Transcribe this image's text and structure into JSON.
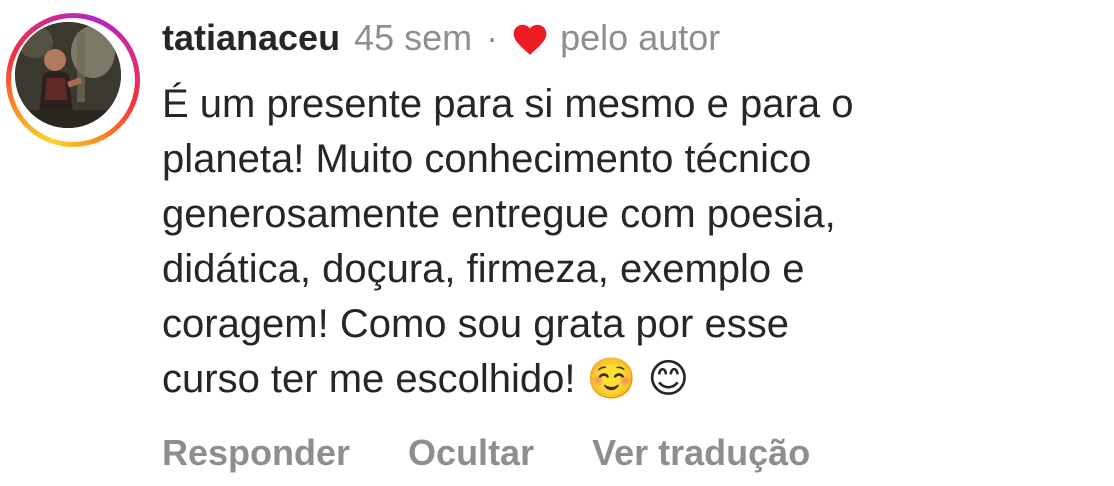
{
  "comment": {
    "username": "tatianaceu",
    "timestamp": "45 sem",
    "separator": "·",
    "liked_by": "pelo autor",
    "heart_color": "#ed1c24",
    "text": "É um presente para si mesmo e para o\nplaneta! Muito conhecimento técnico\ngenerosamente entregue com poesia,\ndidática, doçura, firmeza, exemplo e\ncoragem! Como sou grata por esse\ncurso ter me escolhido! ☺️ 😊",
    "story_ring_colors": [
      "#fdd52c",
      "#fa8a1f",
      "#f1323f",
      "#d62a8a",
      "#b425c8"
    ]
  },
  "actions": {
    "reply": "Responder",
    "hide": "Ocultar",
    "translate": "Ver tradução"
  }
}
